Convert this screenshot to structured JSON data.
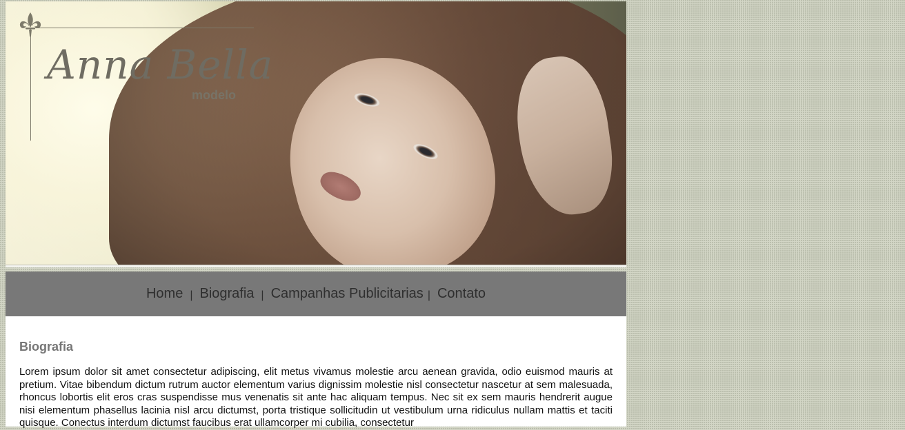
{
  "header": {
    "logo_name": "Anna Bella",
    "logo_sub": "modelo"
  },
  "nav": {
    "items": [
      {
        "label": "Home"
      },
      {
        "label": "Biografia"
      },
      {
        "label": "Campanhas Publicitarias"
      },
      {
        "label": "Contato"
      }
    ],
    "separator": "|"
  },
  "content": {
    "title": "Biografia",
    "body": "Lorem ipsum dolor sit amet consectetur adipiscing, elit metus vivamus molestie arcu aenean gravida, odio euismod mauris at pretium. Vitae bibendum dictum rutrum auctor elementum varius dignissim molestie nisl consectetur nascetur at sem malesuada, rhoncus lobortis elit eros cras suspendisse mus venenatis sit ante hac aliquam tempus. Nec sit ex sem mauris hendrerit augue nisi elementum phasellus lacinia nisl arcu dictumst, porta tristique sollicitudin ut vestibulum urna ridiculus nullam mattis et taciti quisque. Conectus interdum dictumst faucibus erat ullamcorper mi cubilia, consectetur"
  },
  "icons": {
    "logo_ornament": "fleur-de-lis-icon"
  },
  "colors": {
    "nav_background": "#787878",
    "nav_text": "#2f2f2f",
    "heading": "#767676",
    "page_background": "#d3d6c6"
  }
}
